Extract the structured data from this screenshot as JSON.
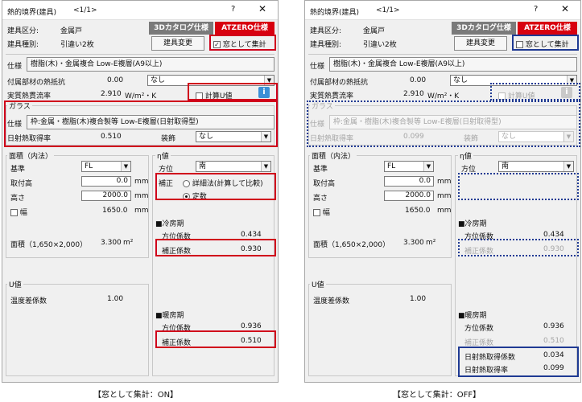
{
  "left": {
    "title": "熱的境界(建具)",
    "page": "<1/1>",
    "help": "?",
    "close": "✕",
    "kubun_label": "建具区分:",
    "kubun_value": "金属戸",
    "shubetsu_label": "建具種別:",
    "shubetsu_value": "引違い2枚",
    "tab_catalog": "3Dカタログ仕様",
    "tab_atzero": "ATZERO仕様",
    "btn_change": "建具変更",
    "window_check_label": "窓として集計",
    "window_check_mark": "✓",
    "spec_label": "仕様",
    "spec_value": "樹脂(木)・金属複合 Low-E複層(A9以上)",
    "fuzoku_label": "付属部材の熱抵抗",
    "fuzoku_value": "0.00",
    "fuzoku_select": "なし",
    "netsu_label": "実質熱貫流率",
    "netsu_value": "2.910",
    "netsu_unit": "W/m²・K",
    "calc_u_label": "計算U値",
    "info_icon_text": "i",
    "glass_group_label": "ガラス",
    "glass_spec_label": "仕様",
    "glass_spec_value": "枠:金属・樹脂(木)複合製等 Low-E複層(日射取得型)",
    "nissha_label": "日射熱取得率",
    "nissha_value": "0.510",
    "soshoku_label": "装飾",
    "soshoku_select": "なし",
    "menseki_group_label": "面積（内法）",
    "kijun_label": "基準",
    "kijun_select": "FL",
    "toritsuke_label": "取付高",
    "toritsuke_value": "0.0",
    "toritsuke_unit": "mm",
    "takasa_label": "高さ",
    "takasa_value": "2000.0",
    "takasa_unit": "mm",
    "haba_label": "幅",
    "haba_value": "1650.0",
    "haba_unit": "mm",
    "menseki_label": "面積（1,650×2,000）",
    "menseki_value": "3.300",
    "menseki_unit": "m²",
    "eta_group_label": "η値",
    "houi_label": "方位",
    "houi_select": "南",
    "hosei_label": "補正",
    "radio1_label": "詳細法(計算して比較)",
    "radio2_label": "定数",
    "reibo_label": "■冷房期",
    "reibo_houi_label": "方位係数",
    "reibo_houi_value": "0.434",
    "reibo_hosei_label": "補正係数",
    "reibo_hosei_value": "0.930",
    "u_group_label": "U値",
    "ondosa_label": "温度差係数",
    "ondosa_value": "1.00",
    "danbo_label": "■暖房期",
    "danbo_houi_label": "方位係数",
    "danbo_houi_value": "0.936",
    "danbo_hosei_label": "補正係数",
    "danbo_hosei_value": "0.510"
  },
  "right": {
    "title": "熱的境界(建具)",
    "page": "<1/1>",
    "help": "?",
    "close": "✕",
    "kubun_label": "建具区分:",
    "kubun_value": "金属戸",
    "shubetsu_label": "建具種別:",
    "shubetsu_value": "引違い2枚",
    "tab_catalog": "3Dカタログ仕様",
    "tab_atzero": "ATZERO仕様",
    "btn_change": "建具変更",
    "window_check_label": "窓として集計",
    "spec_label": "仕様",
    "spec_value": "樹脂(木)・金属複合 Low-E複層(A9以上)",
    "fuzoku_label": "付属部材の熱抵抗",
    "fuzoku_value": "0.00",
    "fuzoku_select": "なし",
    "netsu_label": "実質熱貫流率",
    "netsu_value": "2.910",
    "netsu_unit": "W/m²・K",
    "calc_u_label": "計算U値",
    "info_icon_text": "i",
    "glass_group_label": "ガラス",
    "glass_spec_label": "仕様",
    "glass_spec_value": "枠:金属・樹脂(木)複合製等 Low-E複層(日射取得型)",
    "nissha_label": "日射熱取得率",
    "nissha_value": "0.099",
    "soshoku_label": "装飾",
    "soshoku_select": "なし",
    "menseki_group_label": "面積（内法）",
    "kijun_label": "基準",
    "kijun_select": "FL",
    "toritsuke_label": "取付高",
    "toritsuke_value": "0.0",
    "toritsuke_unit": "mm",
    "takasa_label": "高さ",
    "takasa_value": "2000.0",
    "takasa_unit": "mm",
    "haba_label": "幅",
    "haba_value": "1650.0",
    "haba_unit": "mm",
    "menseki_label": "面積（1,650×2,000）",
    "menseki_value": "3.300",
    "menseki_unit": "m²",
    "eta_group_label": "η値",
    "houi_label": "方位",
    "houi_select": "南",
    "reibo_label": "■冷房期",
    "reibo_houi_label": "方位係数",
    "reibo_houi_value": "0.434",
    "reibo_hosei_label": "補正係数",
    "reibo_hosei_value": "0.930",
    "u_group_label": "U値",
    "ondosa_label": "温度差係数",
    "ondosa_value": "1.00",
    "danbo_label": "■暖房期",
    "danbo_houi_label": "方位係数",
    "danbo_houi_value": "0.936",
    "danbo_hosei_label": "補正係数",
    "danbo_hosei_value": "0.510",
    "nissha_keisu_label": "日射熱取得係数",
    "nissha_keisu_value": "0.034",
    "nissha_ritsu_label": "日射熱取得率",
    "nissha_ritsu_value": "0.099"
  },
  "captions": {
    "on": "【窓として集計：ON】",
    "off": "【窓として集計：OFF】"
  },
  "colors": {
    "highlight_red": "#d0011b",
    "highlight_blue": "#1f3a93",
    "atzero_tab": "#d8000f",
    "catalog_tab": "#7a7a7a",
    "info_icon": "#3b8fd6"
  }
}
